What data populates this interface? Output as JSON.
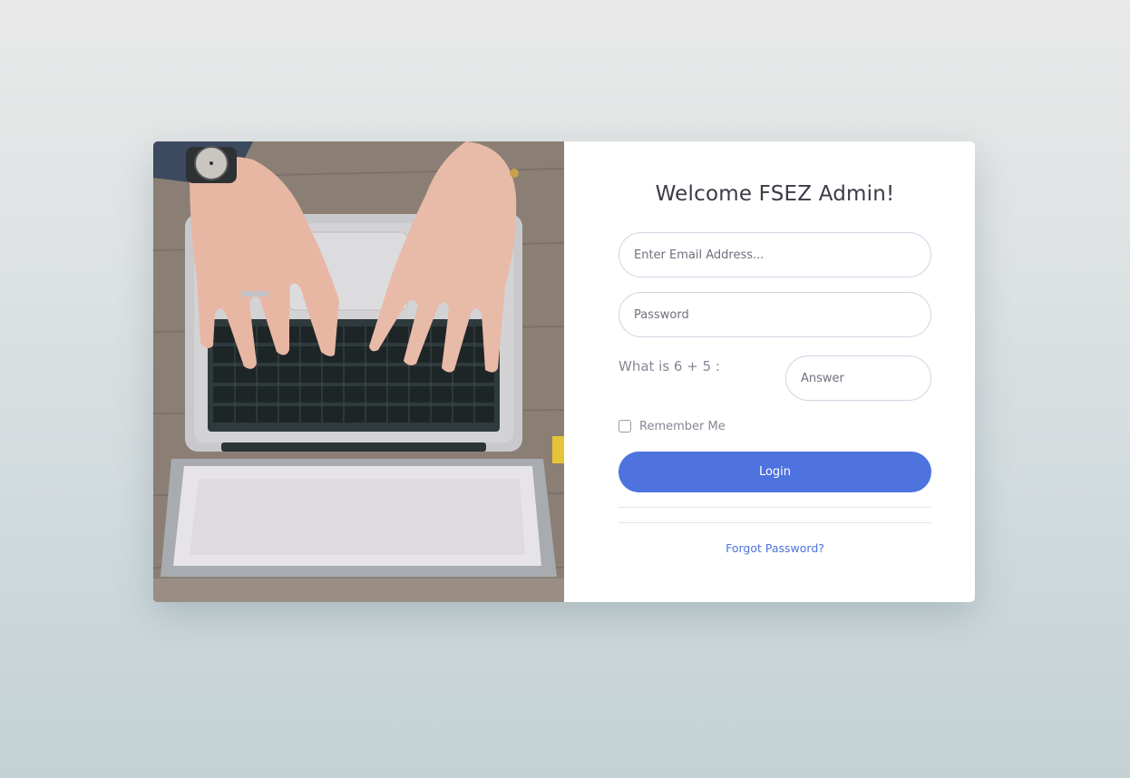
{
  "login": {
    "title": "Welcome FSEZ Admin!",
    "email_placeholder": "Enter Email Address...",
    "password_placeholder": "Password",
    "captcha_question": "What is 6 + 5 :",
    "answer_placeholder": "Answer",
    "remember_label": "Remember Me",
    "remember_checked": false,
    "login_button": "Login",
    "forgot_link": "Forgot Password?"
  },
  "image": {
    "icon": "laptop-typing-photo"
  },
  "colors": {
    "primary": "#4e73df",
    "heading": "#3a3b45",
    "muted_text": "#858796",
    "input_border": "#d1d3e2"
  }
}
